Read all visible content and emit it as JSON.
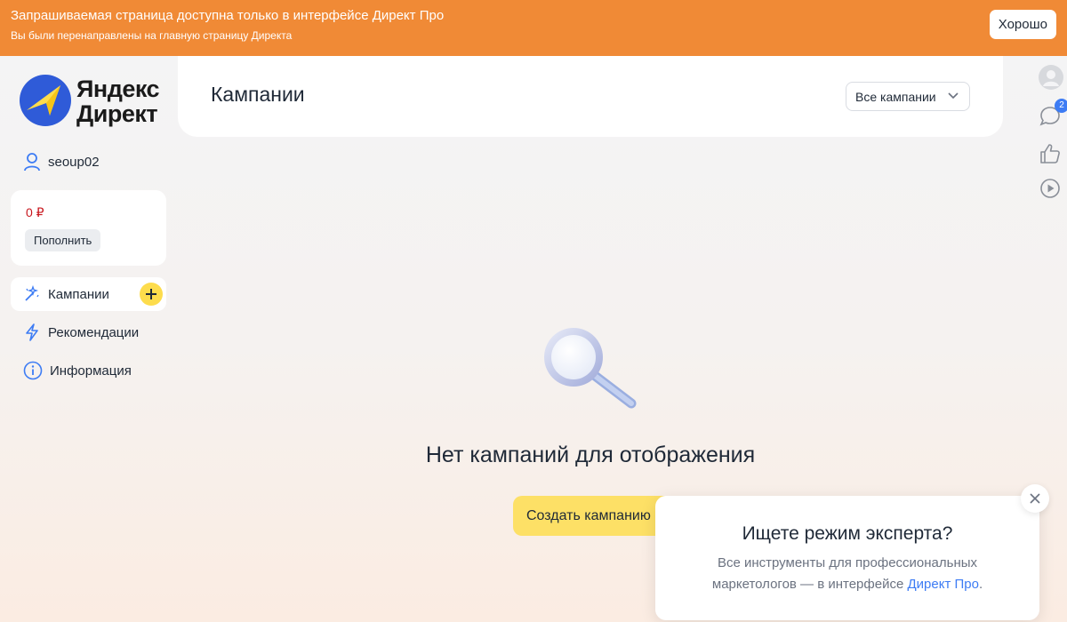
{
  "notification": {
    "title": "Запрашиваемая страница доступна только в интерфейсе Директ Про",
    "subtitle": "Вы были перенаправлены на главную страницу Директа",
    "ok_label": "Хорошо"
  },
  "logo": {
    "line1": "Яндекс",
    "line2": "Директ"
  },
  "user": {
    "name": "seoup02"
  },
  "balance": {
    "amount": "0 ₽",
    "topup_label": "Пополнить"
  },
  "nav": {
    "campaigns": "Кампании",
    "recommendations": "Рекомендации",
    "info": "Информация"
  },
  "header": {
    "title": "Кампании",
    "filter_value": "Все кампании"
  },
  "rail": {
    "chat_badge": "2"
  },
  "empty": {
    "title": "Нет кампаний для отображения",
    "create_label": "Создать кампанию"
  },
  "expert_popup": {
    "title": "Ищете режим эксперта?",
    "body": "Все инструменты для профессиональных маркетологов — в интерфейсе",
    "link": "Директ Про",
    "end": "."
  },
  "colors": {
    "notification_bg": "#f08a36",
    "accent_yellow": "#fde066",
    "link_blue": "#3d7cf4",
    "balance_red": "#c8161d"
  }
}
